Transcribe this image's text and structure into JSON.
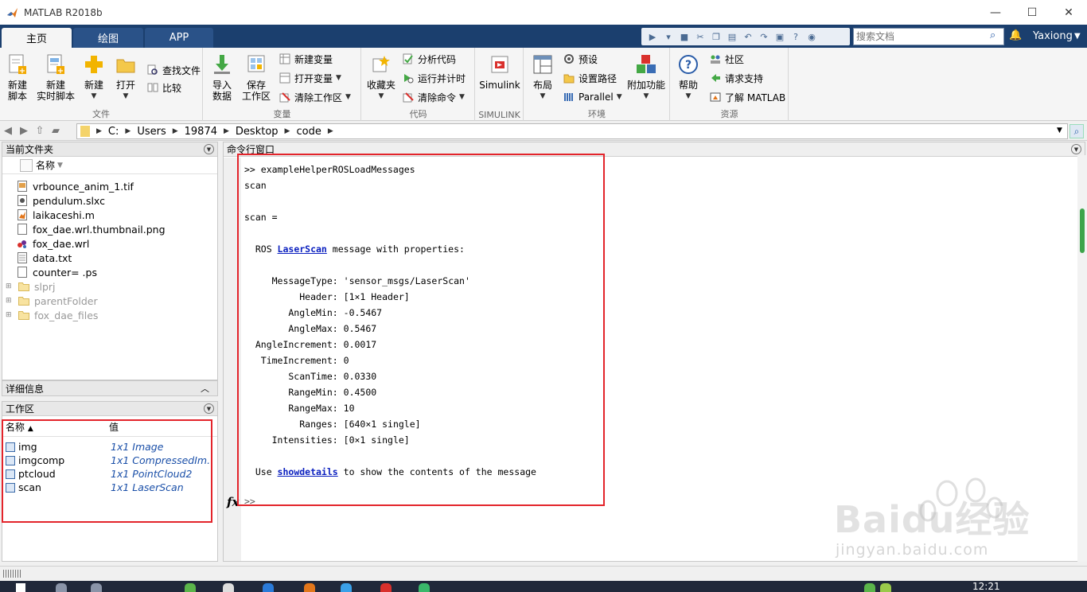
{
  "window": {
    "title": "MATLAB R2018b",
    "minimize": "—",
    "maximize": "☐",
    "close": "✕"
  },
  "tabs": [
    {
      "label": "主页",
      "active": true
    },
    {
      "label": "绘图",
      "active": false
    },
    {
      "label": "APP",
      "active": false
    }
  ],
  "search": {
    "placeholder": "搜索文档"
  },
  "user": {
    "name": "Yaxiong"
  },
  "ribbon": {
    "file": {
      "group_label": "文件",
      "new_script": "新建\n脚本",
      "new_live_script": "新建\n实时脚本",
      "new": "新建",
      "open": "打开",
      "find_files": "查找文件",
      "compare": "比较"
    },
    "variable": {
      "group_label": "变量",
      "import_data": "导入\n数据",
      "save_workspace": "保存\n工作区",
      "new_variable": "新建变量",
      "open_variable": "打开变量",
      "clear_workspace": "清除工作区"
    },
    "code": {
      "group_label": "代码",
      "favorites": "收藏夹",
      "analyze_code": "分析代码",
      "run_and_time": "运行并计时",
      "clear_commands": "清除命令"
    },
    "simulink": {
      "group_label": "SIMULINK",
      "simulink": "Simulink"
    },
    "environment": {
      "group_label": "环境",
      "layout": "布局",
      "preferences": "预设",
      "set_path": "设置路径",
      "parallel": "Parallel",
      "addons": "附加功能"
    },
    "resources": {
      "group_label": "资源",
      "help": "帮助",
      "community": "社区",
      "request_support": "请求支持",
      "learn_matlab": "了解 MATLAB"
    }
  },
  "address": {
    "path": [
      "C:",
      "Users",
      "19874",
      "Desktop",
      "code"
    ]
  },
  "current_folder": {
    "title": "当前文件夹",
    "column_name": "名称",
    "files": [
      {
        "name": "vrbounce_anim_1.tif",
        "icon": "tif-icon"
      },
      {
        "name": "pendulum.slxc",
        "icon": "slxc-icon"
      },
      {
        "name": "laikaceshi.m",
        "icon": "m-file-icon"
      },
      {
        "name": "fox_dae.wrl.thumbnail.png",
        "icon": "file-icon"
      },
      {
        "name": "fox_dae.wrl",
        "icon": "wrl-icon"
      },
      {
        "name": "data.txt",
        "icon": "text-file-icon"
      },
      {
        "name": "counter= .ps",
        "icon": "file-icon"
      }
    ],
    "folders": [
      {
        "name": "slprj"
      },
      {
        "name": "parentFolder"
      },
      {
        "name": "fox_dae_files"
      }
    ]
  },
  "details": {
    "title": "详细信息"
  },
  "workspace": {
    "title": "工作区",
    "col_name": "名称",
    "col_value": "值",
    "vars": [
      {
        "name": "img",
        "value": "1x1 Image"
      },
      {
        "name": "imgcomp",
        "value": "1x1 CompressedIm..."
      },
      {
        "name": "ptcloud",
        "value": "1x1 PointCloud2"
      },
      {
        "name": "scan",
        "value": "1x1 LaserScan"
      }
    ]
  },
  "command_window": {
    "title": "命令行窗口",
    "lines": {
      "l1": ">> exampleHelperROSLoadMessages",
      "l2": "scan",
      "l3": "scan =",
      "l4_pre": "  ROS ",
      "l4_link": "LaserScan",
      "l4_post": " message with properties:",
      "props": [
        {
          "key": "     MessageType",
          "val": "'sensor_msgs/LaserScan'"
        },
        {
          "key": "          Header",
          "val": "[1×1 Header]"
        },
        {
          "key": "        AngleMin",
          "val": "-0.5467"
        },
        {
          "key": "        AngleMax",
          "val": "0.5467"
        },
        {
          "key": "  AngleIncrement",
          "val": "0.0017"
        },
        {
          "key": "   TimeIncrement",
          "val": "0"
        },
        {
          "key": "        ScanTime",
          "val": "0.0330"
        },
        {
          "key": "        RangeMin",
          "val": "0.4500"
        },
        {
          "key": "        RangeMax",
          "val": "10"
        },
        {
          "key": "          Ranges",
          "val": "[640×1 single]"
        },
        {
          "key": "     Intensities",
          "val": "[0×1 single]"
        }
      ],
      "use_pre": "  Use ",
      "use_link": "showdetails",
      "use_post": " to show the contents of the message"
    },
    "prompt": ">>",
    "fx": "fx"
  },
  "taskbar": {
    "time": "12:21"
  },
  "watermark": {
    "text": "Baidu经验",
    "sub": "jingyan.baidu.com"
  },
  "colors": {
    "accent": "#1b3f6e",
    "highlight": "#e3242b",
    "link": "#0a1fbf"
  }
}
